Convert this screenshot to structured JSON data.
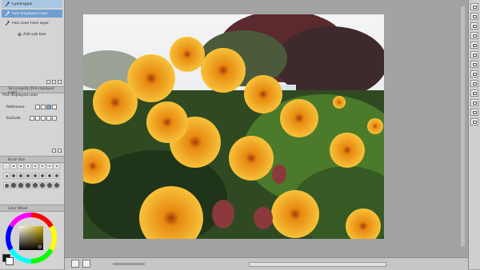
{
  "tool_list": {
    "items": [
      {
        "label": "Eyedropper",
        "icon": "eyedropper-icon",
        "selected": true
      },
      {
        "label": "Pick displayed color",
        "icon": "eyedropper-icon",
        "selected": true
      },
      {
        "label": "Pick color from layer",
        "icon": "eyedropper-icon",
        "selected": false
      }
    ],
    "add_sub_tool": "Add sub tool"
  },
  "tool_property": {
    "header": "Tool property [Pick displayed color]",
    "subtitle": "Pick displayed color",
    "reference_label": "Reference",
    "exclude_label": "Exclude"
  },
  "brush_size": {
    "header": "Brush Size",
    "sizes": [
      "0.7",
      "1",
      "1.5",
      "2",
      "2.5",
      "3",
      "4",
      "5",
      "6",
      "7",
      "8",
      "10",
      "12",
      "15",
      "17",
      "20",
      "25",
      "30",
      "40",
      "50",
      "60",
      "70",
      "80",
      "100"
    ]
  },
  "color_wheel": {
    "header": "Color Wheel",
    "main_color": "#111111",
    "sub_color": "#ffffff"
  },
  "colors": {
    "panel_bg": "#d4d4d4",
    "selected_row": "#a9c6e3",
    "workspace": "#a3a3a3"
  }
}
